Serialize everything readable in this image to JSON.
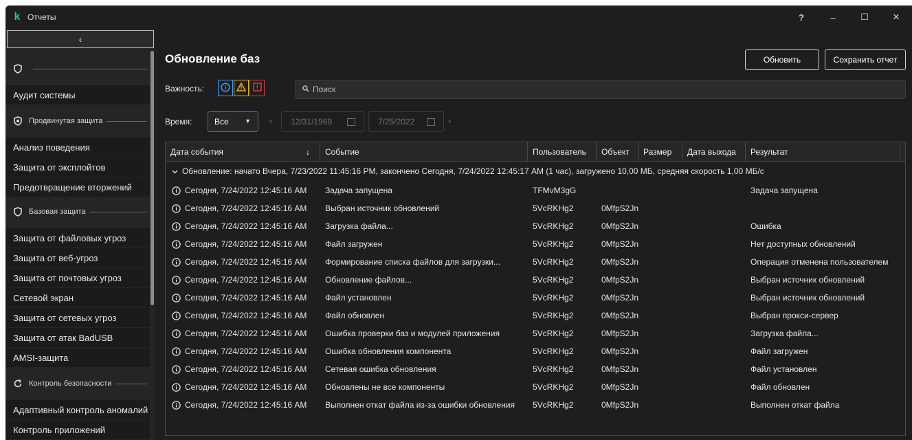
{
  "window": {
    "title": "Отчеты",
    "help_glyph": "?",
    "minimize_glyph": "–",
    "maximize_glyph": "☐",
    "close_glyph": "✕"
  },
  "sidebar": {
    "collapse_glyph": "‹",
    "groups": [
      {
        "label": "",
        "icon": "shield-icon"
      },
      {
        "label": "Продвинутая защита",
        "icon": "shield-advanced-icon"
      },
      {
        "label": "Базовая защита",
        "icon": "shield-basic-icon"
      },
      {
        "label": "Контроль безопасности",
        "icon": "refresh-shield-icon"
      }
    ],
    "items": [
      "Аудит системы",
      "Анализ поведения",
      "Защита от эксплойтов",
      "Предотвращение вторжений",
      "Защита от файловых угроз",
      "Защита от веб-угроз",
      "Защита от почтовых угроз",
      "Сетевой экран",
      "Защита от сетевых угроз",
      "Защита от атак BadUSB",
      "AMSI-защита",
      "Адаптивный контроль аномалий",
      "Контроль приложений"
    ]
  },
  "main": {
    "title": "Обновление баз",
    "refresh_label": "Обновить",
    "save_label": "Сохранить отчет",
    "severity_label": "Важность:",
    "search_placeholder": "Поиск",
    "time_label": "Время:",
    "time_select": "Все",
    "date_from": "12/31/1969",
    "date_to": "7/25/2022"
  },
  "colors": {
    "info": "#3aa0ff",
    "warning": "#f2b100",
    "critical": "#e53935",
    "accent": "#1fc98b"
  },
  "table": {
    "columns": [
      "Дата события",
      "Событие",
      "Пользователь",
      "Объект",
      "Размер",
      "Дата выхода",
      "Результат"
    ],
    "sort_glyph": "↓",
    "group_header": "Обновление: начато Вчера, 7/23/2022 11:45:16 PM, закончено Сегодня, 7/24/2022 12:45:17 AM (1 час), загружено 10,00 МБ, средняя скорость 1,00 МБ/с",
    "rows": [
      {
        "date": "Сегодня, 7/24/2022 12:45:16 AM",
        "event": "Задача запущена",
        "user": "TFMvM3gG",
        "object": "",
        "result": "Задача запущена"
      },
      {
        "date": "Сегодня, 7/24/2022 12:45:16 AM",
        "event": "Выбран источник обновлений",
        "user": "5VcRKHg2",
        "object": "0MfpS2Jn",
        "result": ""
      },
      {
        "date": "Сегодня, 7/24/2022 12:45:16 AM",
        "event": "Загрузка файла...",
        "user": "5VcRKHg2",
        "object": "0MfpS2Jn",
        "result": "Ошибка"
      },
      {
        "date": "Сегодня, 7/24/2022 12:45:16 AM",
        "event": "Файл загружен",
        "user": "5VcRKHg2",
        "object": "0MfpS2Jn",
        "result": "Нет доступных обновлений"
      },
      {
        "date": "Сегодня, 7/24/2022 12:45:16 AM",
        "event": "Формирование списка файлов для загрузки...",
        "user": "5VcRKHg2",
        "object": "0MfpS2Jn",
        "result": "Операция отменена пользователем"
      },
      {
        "date": "Сегодня, 7/24/2022 12:45:16 AM",
        "event": "Обновление файлов...",
        "user": "5VcRKHg2",
        "object": "0MfpS2Jn",
        "result": "Выбран источник обновлений"
      },
      {
        "date": "Сегодня, 7/24/2022 12:45:16 AM",
        "event": "Файл установлен",
        "user": "5VcRKHg2",
        "object": "0MfpS2Jn",
        "result": "Выбран источник обновлений"
      },
      {
        "date": "Сегодня, 7/24/2022 12:45:16 AM",
        "event": "Файл обновлен",
        "user": "5VcRKHg2",
        "object": "0MfpS2Jn",
        "result": "Выбран прокси-сервер"
      },
      {
        "date": "Сегодня, 7/24/2022 12:45:16 AM",
        "event": "Ошибка проверки баз и модулей приложения",
        "user": "5VcRKHg2",
        "object": "0MfpS2Jn",
        "result": "Загрузка файла..."
      },
      {
        "date": "Сегодня, 7/24/2022 12:45:16 AM",
        "event": "Ошибка обновления компонента",
        "user": "5VcRKHg2",
        "object": "0MfpS2Jn",
        "result": "Файл загружен"
      },
      {
        "date": "Сегодня, 7/24/2022 12:45:16 AM",
        "event": "Сетевая ошибка обновления",
        "user": "5VcRKHg2",
        "object": "0MfpS2Jn",
        "result": "Файл установлен"
      },
      {
        "date": "Сегодня, 7/24/2022 12:45:16 AM",
        "event": "Обновлены не все компоненты",
        "user": "5VcRKHg2",
        "object": "0MfpS2Jn",
        "result": "Файл обновлен"
      },
      {
        "date": "Сегодня, 7/24/2022 12:45:16 AM",
        "event": "Выполнен откат файла из-за ошибки обновления",
        "user": "5VcRKHg2",
        "object": "0MfpS2Jn",
        "result": "Выполнен откат файла"
      }
    ]
  }
}
